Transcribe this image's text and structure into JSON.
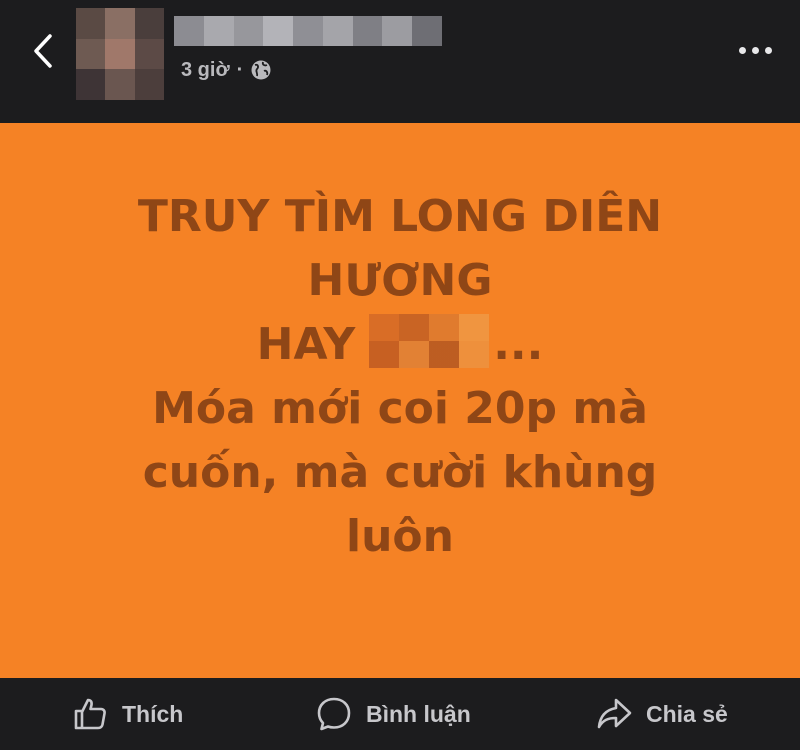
{
  "post": {
    "time": "3 giờ",
    "separator": "·",
    "privacy_icon": "globe-icon",
    "text_lines": {
      "line1": "TRUY TÌM LONG DIÊN",
      "line2": "HƯƠNG",
      "line3_start": "HAY",
      "line3_end": "...",
      "line4": "Móa mới coi 20p mà",
      "line5": "cuốn, mà cười khùng",
      "line6": "luôn"
    },
    "background_color": "#f58225",
    "text_color": "#8f4616"
  },
  "actions": {
    "like": "Thích",
    "comment": "Bình luận",
    "share": "Chia sẻ"
  },
  "icons": {
    "back": "chevron-left-icon",
    "more": "more-horizontal-icon",
    "like": "thumbs-up-icon",
    "comment": "speech-bubble-icon",
    "share": "share-arrow-icon"
  }
}
